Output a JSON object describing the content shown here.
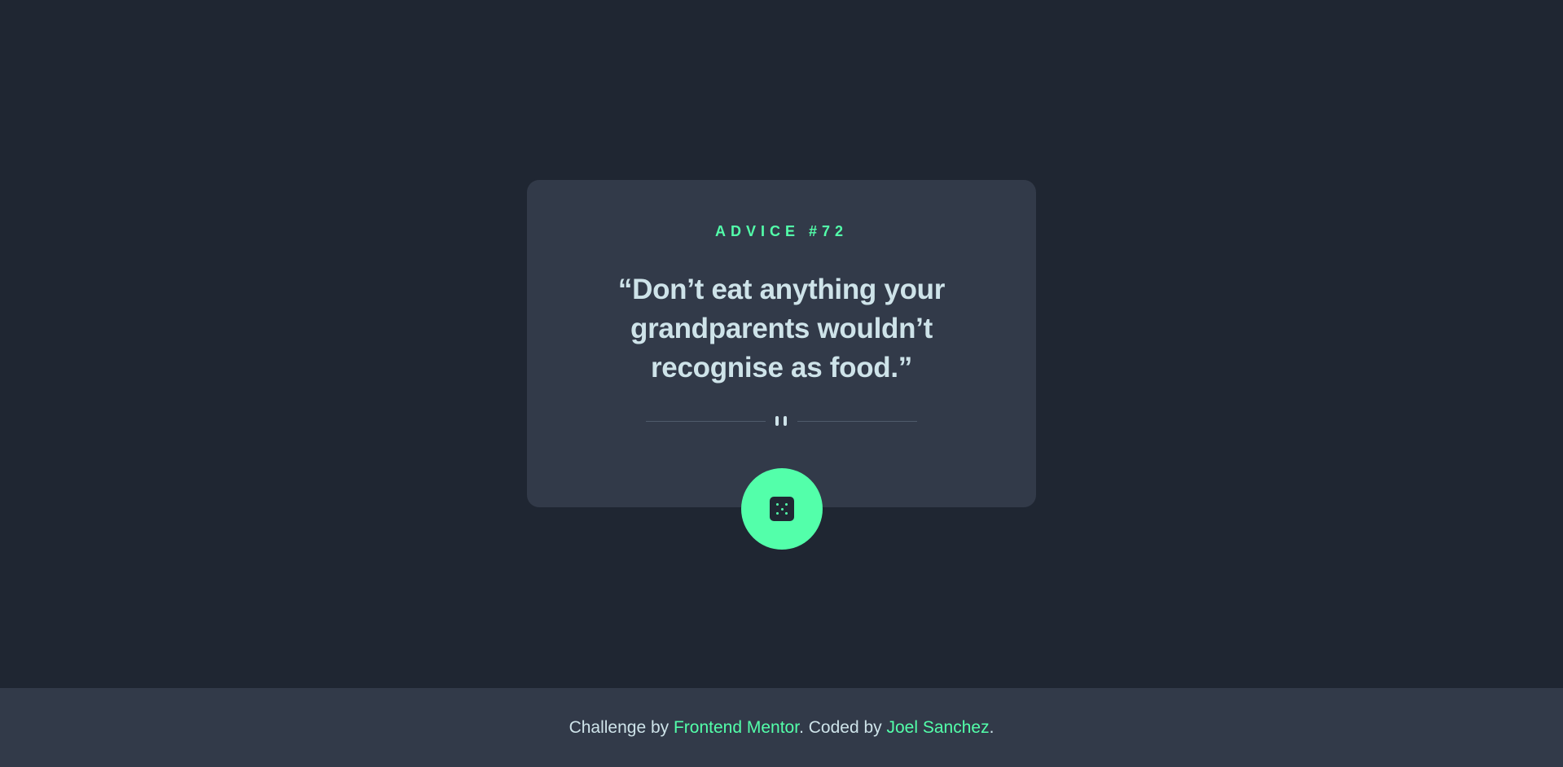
{
  "card": {
    "title": "ADVICE #72",
    "quote_lines": [
      "“Don’t eat anything your",
      "grandparents wouldn’t",
      "recognise as food.”"
    ],
    "divider_icon": "pause-icon",
    "button_icon": "dice-icon"
  },
  "footer": {
    "prefix": "Challenge by ",
    "link1": "Frontend Mentor",
    "middle": ". Coded by ",
    "link2": "Joel Sanchez",
    "suffix": "."
  },
  "colors": {
    "background": "#1f2632",
    "card": "#323a49",
    "accent": "#53ffaa",
    "text": "#cee3e9"
  }
}
